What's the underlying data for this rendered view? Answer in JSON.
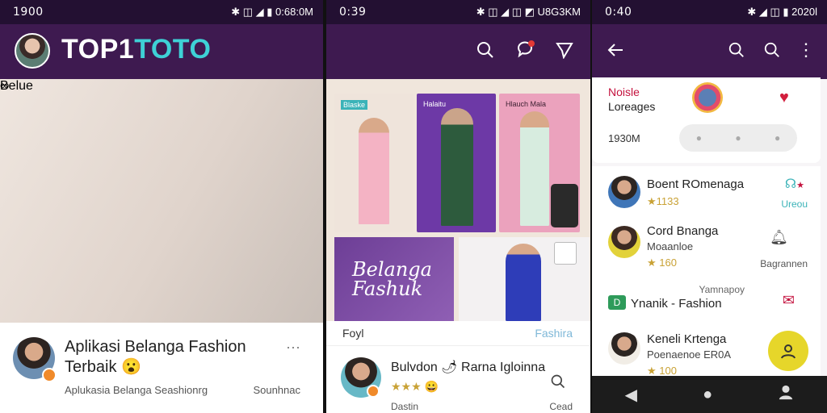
{
  "colors": {
    "header": "#3e1a50",
    "accent": "#3ed1d6",
    "badge": "#f08a2a",
    "fab": "#e6d62a"
  },
  "p1": {
    "time": "1900",
    "status_icons": "✱ ◫ ◢ ▮ 0:68:0M",
    "logo_main": "TOP1",
    "logo_accent": "TOTO",
    "hero_tag": "Belue",
    "post_title": "Aplikasi Belanga Fashion Terbaik 😮",
    "post_sub": "Aplukasia Belanga Seashionrg",
    "post_side": "Sounhnac",
    "more": "···"
  },
  "p2": {
    "time": "0:39",
    "status_icons": "✱ ◫ ◢ ◫ ◩ U8G3KM",
    "card_labels": [
      "Blaske",
      "Halaitu",
      "Hlauch Mala"
    ],
    "banner_line1": "Belanga",
    "banner_line2": "Fashuk",
    "bar_left": "Foyl",
    "bar_right": "Fashira",
    "post_title": "Bulvdon 🌶 Rarna Igloinna",
    "post_stars": "★★★ 😀",
    "post_date": "Dastin",
    "post_side": "Cead"
  },
  "p3": {
    "time": "0:40",
    "status_icons": "✱ ◢ ◫ ▮ 2020l",
    "n1": "Noisle",
    "n2": "Loreages",
    "n3": "1930M",
    "rows": [
      {
        "name": "Boent ROmenaga",
        "sub": "★1133",
        "right": "Ureou"
      },
      {
        "name": "Cord Bnanga",
        "sub": "Moaanloe",
        "stars": "★ 160",
        "right": "Bagrannen"
      },
      {
        "name": "Ynanik - Fashion",
        "sub": "Yamnapoy",
        "right": ""
      },
      {
        "name": "Keneli Krtenga",
        "sub": "Poenaenoe ER0A",
        "stars": "★ 100",
        "right": ""
      }
    ]
  }
}
